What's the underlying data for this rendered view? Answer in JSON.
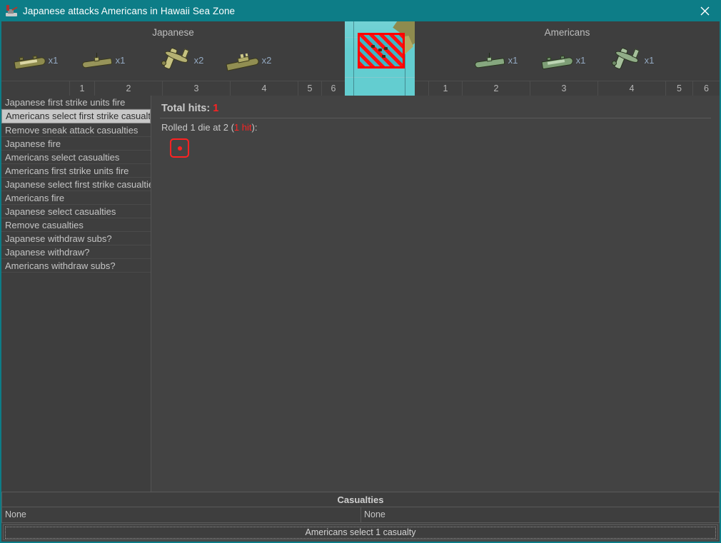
{
  "window": {
    "title": "Japanese attacks Americans in Hawaii Sea Zone",
    "icon": "battle-icon",
    "close_label": "✕",
    "title_bar_color": "#0d7d87",
    "panel_color": "#434343"
  },
  "battle": {
    "attacker": {
      "name": "Japanese",
      "units": [
        {
          "type": "transport",
          "count": "x1",
          "column": 1
        },
        {
          "type": "submarine",
          "count": "x1",
          "column": 2
        },
        {
          "type": "fighter",
          "count": "x2",
          "column": 3
        },
        {
          "type": "battleship",
          "count": "x2",
          "column": 4
        }
      ],
      "columns": [
        "1",
        "2",
        "3",
        "4",
        "5",
        "6"
      ]
    },
    "defender": {
      "name": "Americans",
      "units": [
        {
          "type": "submarine",
          "count": "x1",
          "column": 2
        },
        {
          "type": "transport",
          "count": "x1",
          "column": 3
        },
        {
          "type": "fighter",
          "count": "x1",
          "column": 4
        }
      ],
      "columns": [
        "1",
        "2",
        "3",
        "4",
        "5",
        "6"
      ]
    }
  },
  "steps": {
    "selected_index": 1,
    "items": [
      "Japanese first strike units fire",
      "Americans select first strike casualties",
      "Remove sneak attack casualties",
      "Japanese fire",
      "Americans select casualties",
      "Americans first strike units fire",
      "Japanese select first strike casualties",
      "Americans fire",
      "Japanese select casualties",
      "Remove casualties",
      "Japanese withdraw subs?",
      "Japanese withdraw?",
      "Americans withdraw subs?"
    ]
  },
  "dice": {
    "total_hits_label": "Total hits:",
    "total_hits_value": "1",
    "roll_prefix": "Rolled 1 die at 2 (",
    "roll_hits": "1 hit",
    "roll_suffix": "):",
    "hit_color": "#ff2222",
    "rolls": [
      {
        "value": 1,
        "hit": true
      }
    ]
  },
  "casualties": {
    "header": "Casualties",
    "left_value": "None",
    "right_value": "None"
  },
  "action": {
    "label": "Americans select 1 casualty"
  }
}
